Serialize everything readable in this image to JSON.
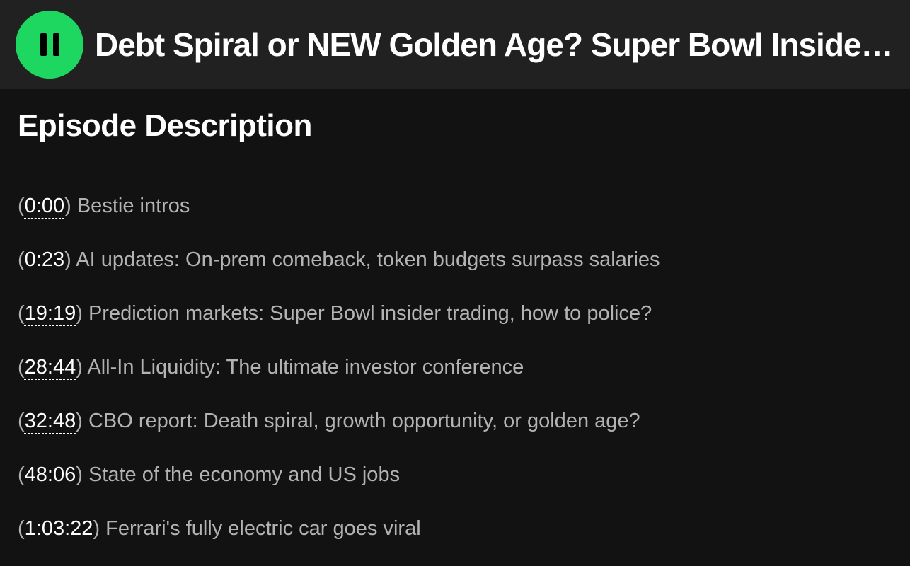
{
  "header": {
    "play_state": "playing",
    "title": "Debt Spiral or NEW Golden Age? Super Bowl Insider Trading, All-In Liquidity, CBO Report, Ferrari EV"
  },
  "section": {
    "heading": "Episode Description"
  },
  "chapters": [
    {
      "time": "0:00",
      "label": "Bestie intros"
    },
    {
      "time": "0:23",
      "label": "AI updates: On-prem comeback, token budgets surpass salaries"
    },
    {
      "time": "19:19",
      "label": "Prediction markets: Super Bowl insider trading, how to police?"
    },
    {
      "time": "28:44",
      "label": "All-In Liquidity: The ultimate investor conference"
    },
    {
      "time": "32:48",
      "label": "CBO report: Death spiral, growth opportunity, or golden age?"
    },
    {
      "time": "48:06",
      "label": "State of the economy and US jobs"
    },
    {
      "time": "1:03:22",
      "label": "Ferrari's fully electric car goes viral"
    }
  ],
  "colors": {
    "accent": "#1ed760",
    "background": "#121212",
    "header_background": "#212121"
  }
}
